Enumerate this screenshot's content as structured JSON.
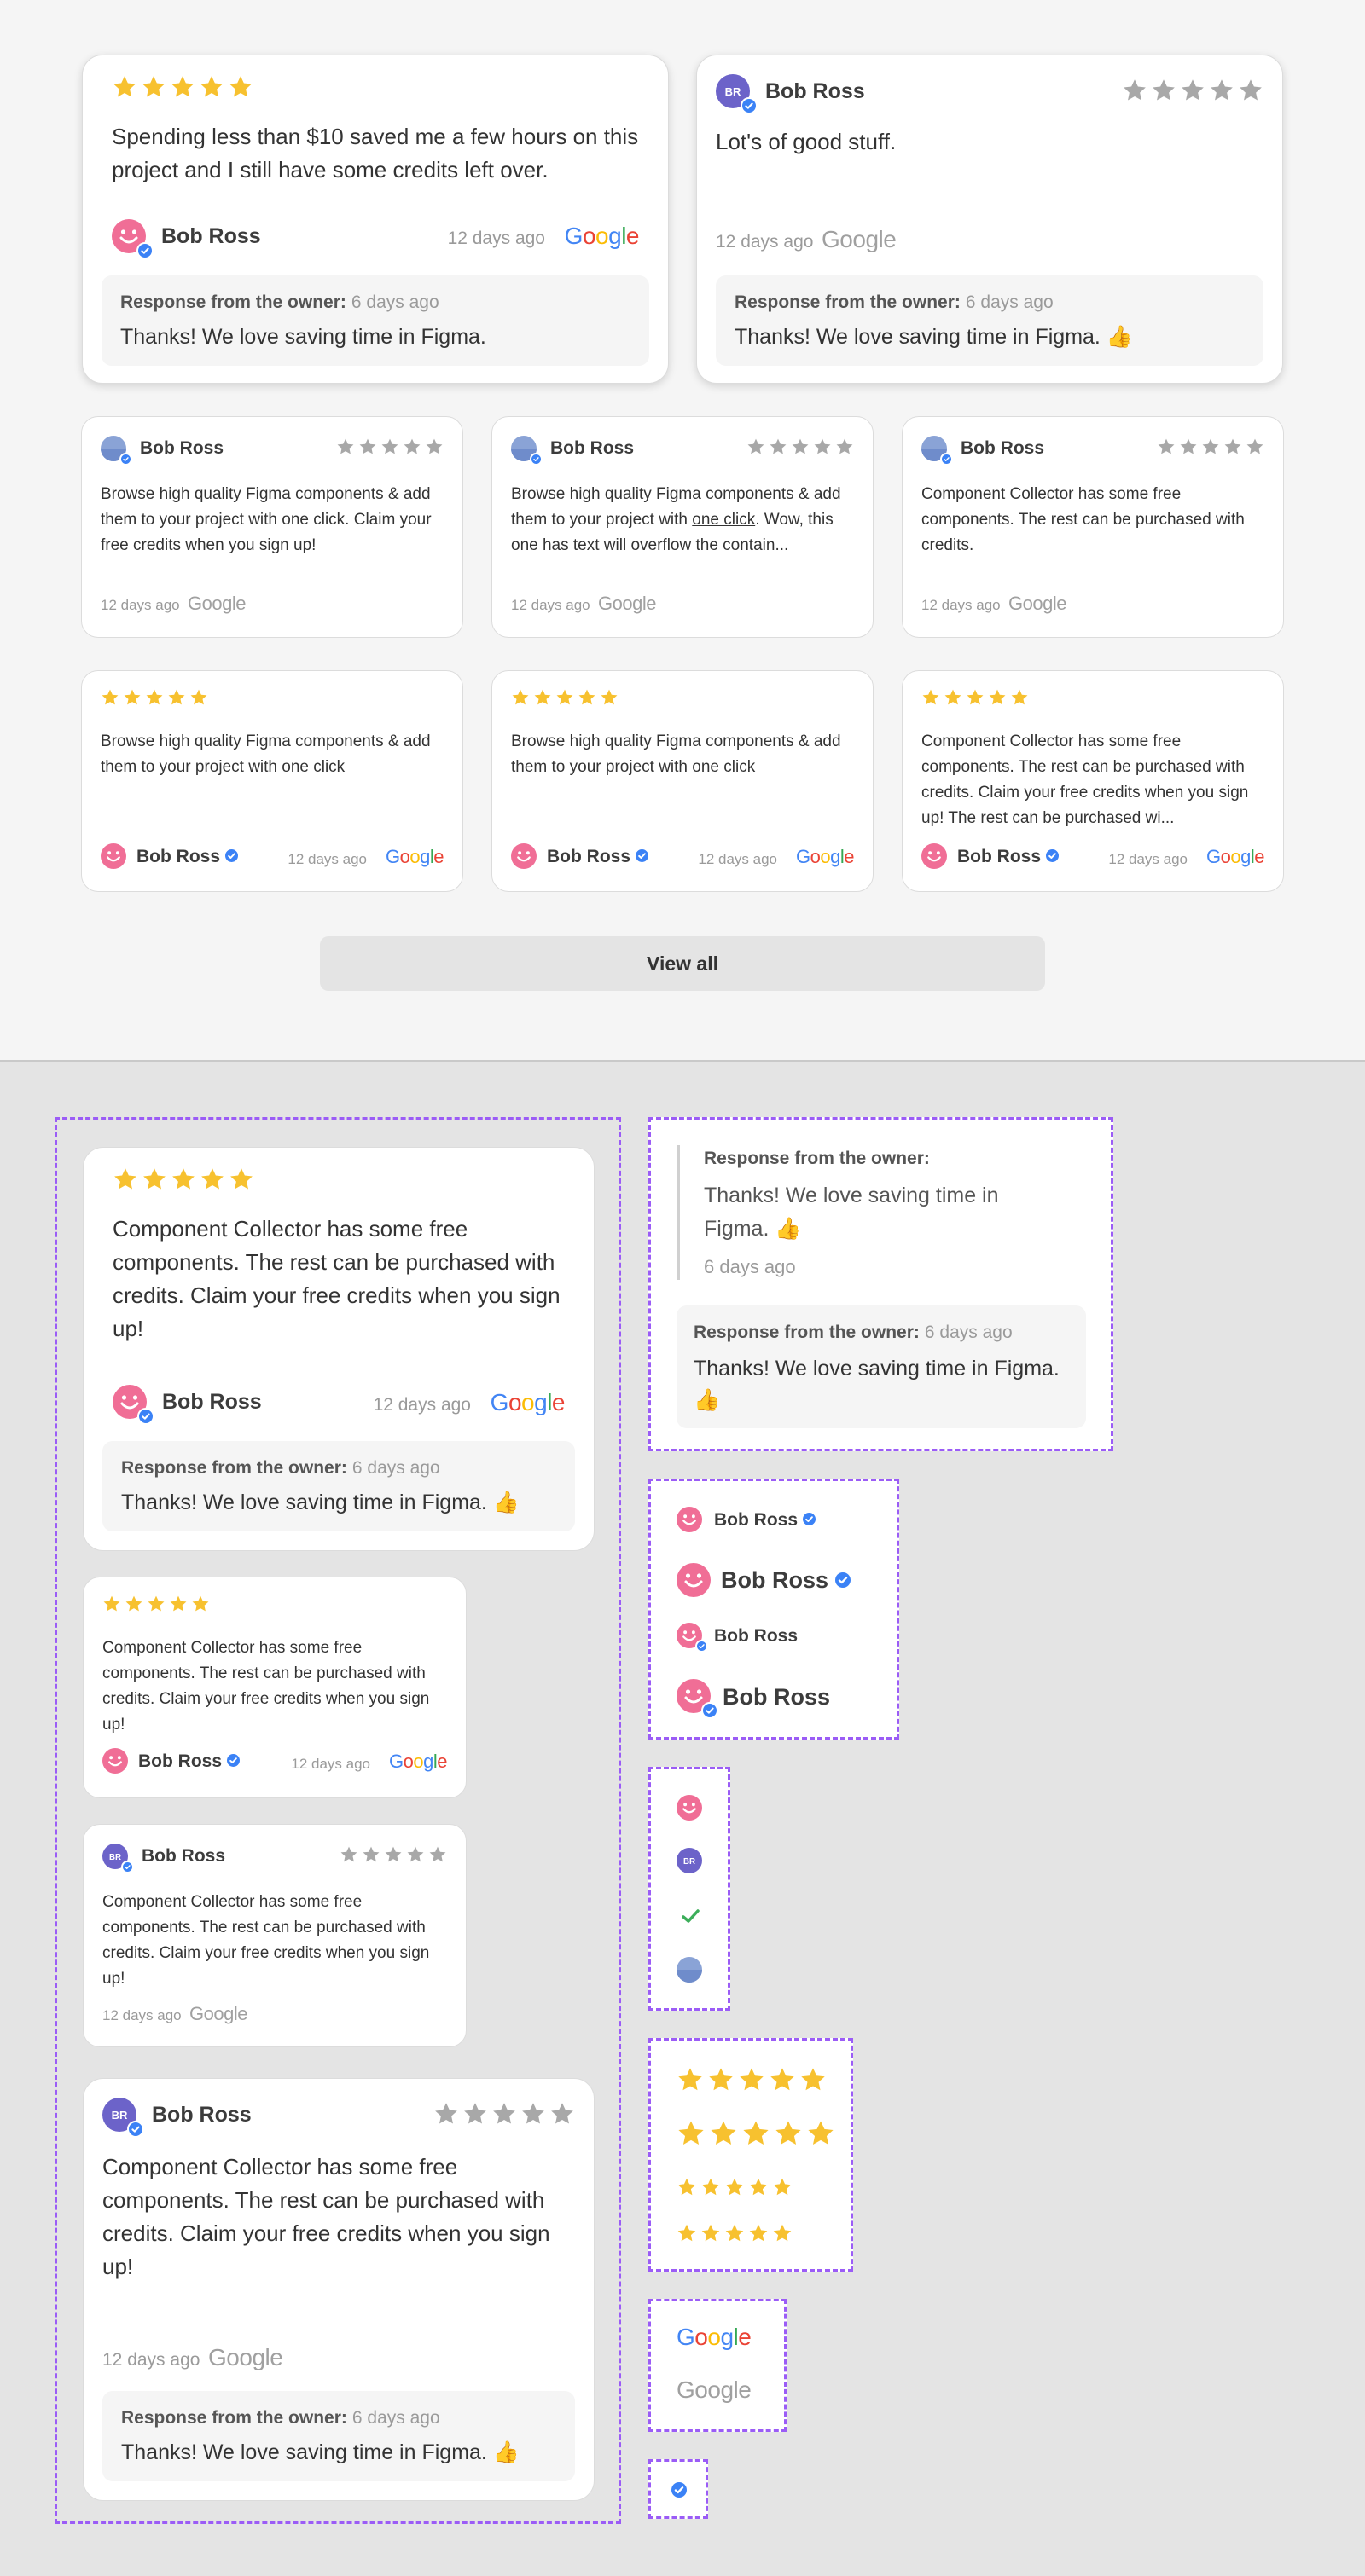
{
  "reviewer_name": "Bob Ross",
  "time_ago": "12 days ago",
  "brand": "Google",
  "response_label": "Response from the owner:",
  "response_time": "6 days ago",
  "response_text": "Thanks!  We love saving time in Figma.",
  "response_text_emoji": "Thanks!  We love saving time in Figma. 👍",
  "avatar_initials": "BR",
  "review_texts": {
    "ten_dollars": "Spending less than $10 saved me a few hours on this project and I still have some credits left over.",
    "good_stuff": "Lot's of good stuff.",
    "browse_signup": "Browse high quality Figma components & add them to your project with one click. Claim your free credits when you sign up!",
    "browse_overflow_a": "Browse high quality Figma components & add them to your project with ",
    "browse_overflow_u": "one click",
    "browse_overflow_b": ". Wow, this one has text will overflow the contain...",
    "collector_short": "Component Collector has some free components. The rest can be purchased with credits.",
    "browse_one_click": "Browse high quality Figma components & add them to your project with one click",
    "browse_a": "Browse high quality Figma components & add them to your project with ",
    "collector_overflow": "Component Collector has some free components. The rest can be purchased with credits. Claim your free credits when you sign up! The rest can be purchased wi...",
    "collector_signup": "Component Collector has some free components. The rest can be purchased with credits. Claim your free credits when you sign up!"
  },
  "view_all_label": "View all",
  "colors": {
    "star_gold": "#f7c12f",
    "star_grey": "#a8a8a8",
    "avatar_pink": "#f06e96",
    "avatar_purple": "#6c63c9",
    "verified_blue": "#3b82f6",
    "dashed_purple": "#9b5cf6",
    "check_green": "#3cae5a"
  },
  "icons": [
    "star-icon",
    "smiley-avatar-icon",
    "verified-badge-icon",
    "check-icon",
    "google-logo"
  ]
}
